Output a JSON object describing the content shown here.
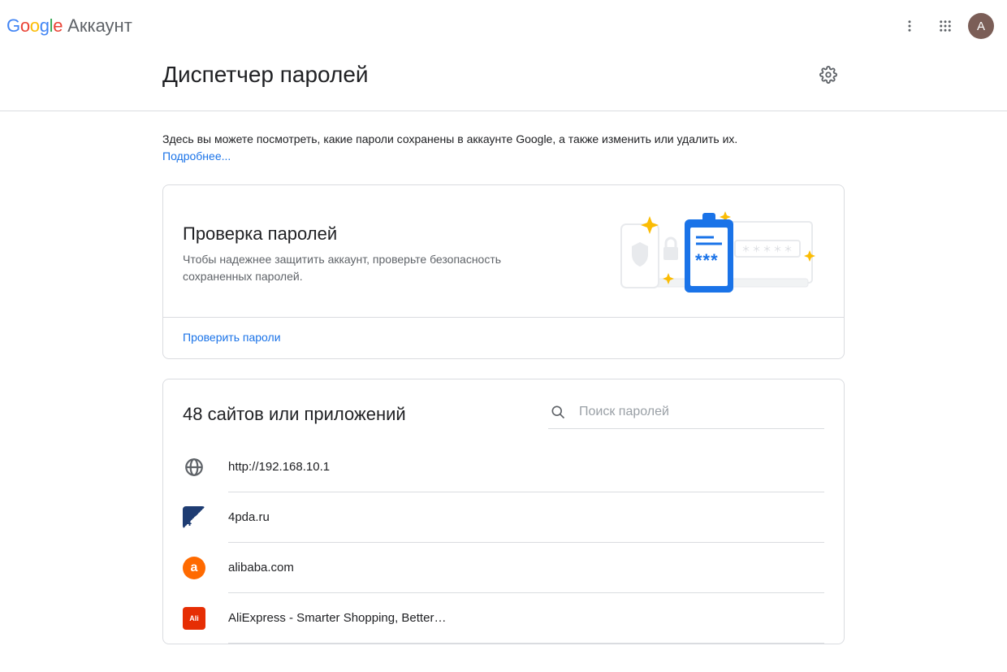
{
  "header": {
    "logo_text": "Google",
    "product": "Аккаунт",
    "avatar_letter": "А"
  },
  "page": {
    "title": "Диспетчер паролей",
    "intro_text": "Здесь вы можете посмотреть, какие пароли сохранены в аккаунте Google, а также изменить или удалить их.",
    "intro_link": "Подробнее..."
  },
  "checkup": {
    "title": "Проверка паролей",
    "desc": "Чтобы надежнее защитить аккаунт, проверьте безопасность сохраненных паролей.",
    "action": "Проверить пароли"
  },
  "list": {
    "count_label": "48 сайтов или приложений",
    "search_placeholder": "Поиск паролей",
    "items": [
      {
        "label": "http://192.168.10.1",
        "icon": "globe",
        "bg": "#ffffff",
        "fg": "#5f6368"
      },
      {
        "label": "4pda.ru",
        "icon": "text",
        "text": "4",
        "bg": "#1e3c72",
        "fg": "#ffffff"
      },
      {
        "label": "alibaba.com",
        "icon": "text",
        "text": "a",
        "bg": "#ff6a00",
        "fg": "#ffffff",
        "round": true
      },
      {
        "label": "AliExpress - Smarter Shopping, Better…",
        "icon": "text",
        "text": "Ali",
        "bg": "#e62e04",
        "fg": "#ffffff"
      }
    ]
  }
}
